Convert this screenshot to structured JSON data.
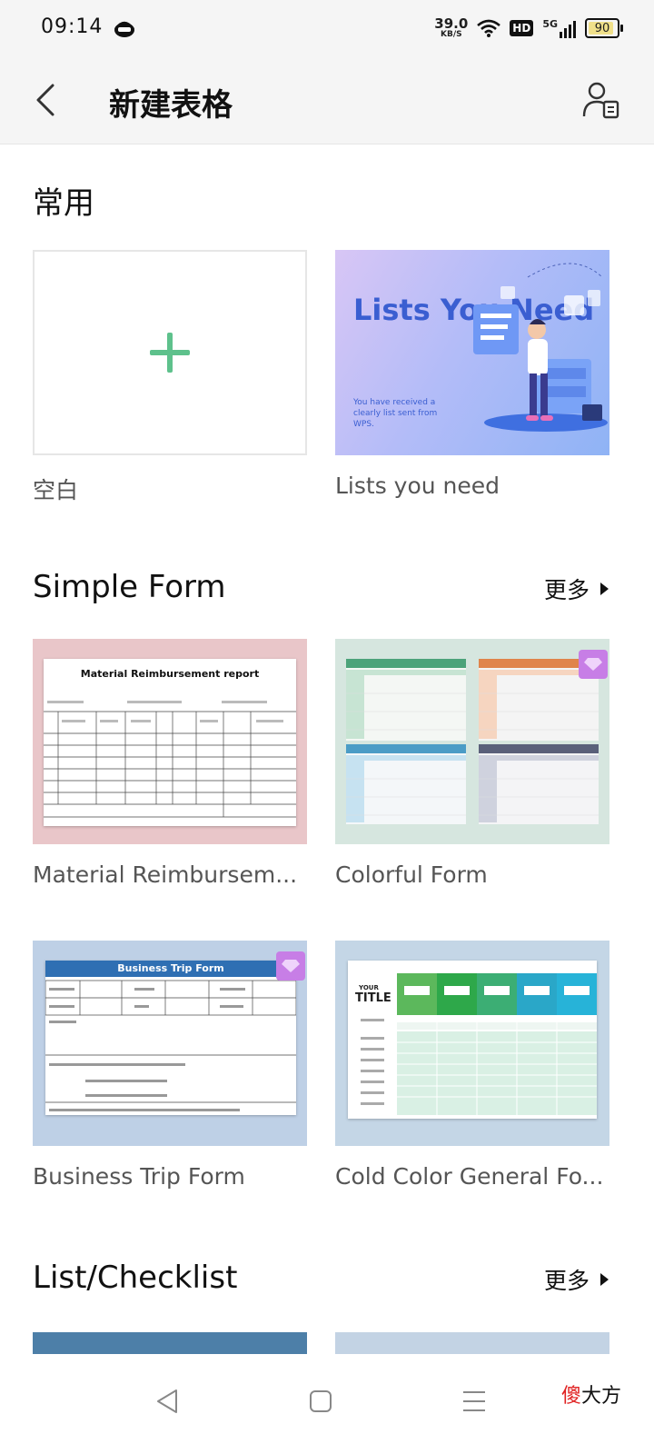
{
  "status_bar": {
    "time": "09:14",
    "net_speed_value": "39.0",
    "net_speed_unit": "KB/S",
    "hd": "HD",
    "signal": "5G",
    "battery": "90",
    "battery_fraction": 0.9
  },
  "app_bar": {
    "title": "新建表格",
    "back_icon": "back-arrow-icon",
    "user_icon": "user-document-icon"
  },
  "sections": [
    {
      "title": "常用",
      "items": [
        {
          "caption": "空白",
          "type": "blank"
        },
        {
          "caption": "Lists you need",
          "thumb_big": "Lists You Need",
          "thumb_sub": "You have received a clearly list sent from WPS."
        }
      ]
    },
    {
      "title": "Simple Form",
      "more": "更多",
      "items": [
        {
          "caption": "Material Reimbursem...",
          "thumb_title": "Material Reimbursement report"
        },
        {
          "caption": "Colorful Form",
          "premium": true
        },
        {
          "caption": "Business Trip Form",
          "thumb_title": "Business Trip Form",
          "premium": true
        },
        {
          "caption": "Cold Color General Fo...",
          "thumb_title": "TITLE",
          "thumb_your": "YOUR"
        }
      ]
    },
    {
      "title": "List/Checklist",
      "more": "更多"
    }
  ],
  "watermark": {
    "part1": "傻",
    "part2": "大方"
  },
  "colors": {
    "accent_green": "#5ec18c",
    "premium": "#c77ee6",
    "watermark_red": "#e02020"
  }
}
